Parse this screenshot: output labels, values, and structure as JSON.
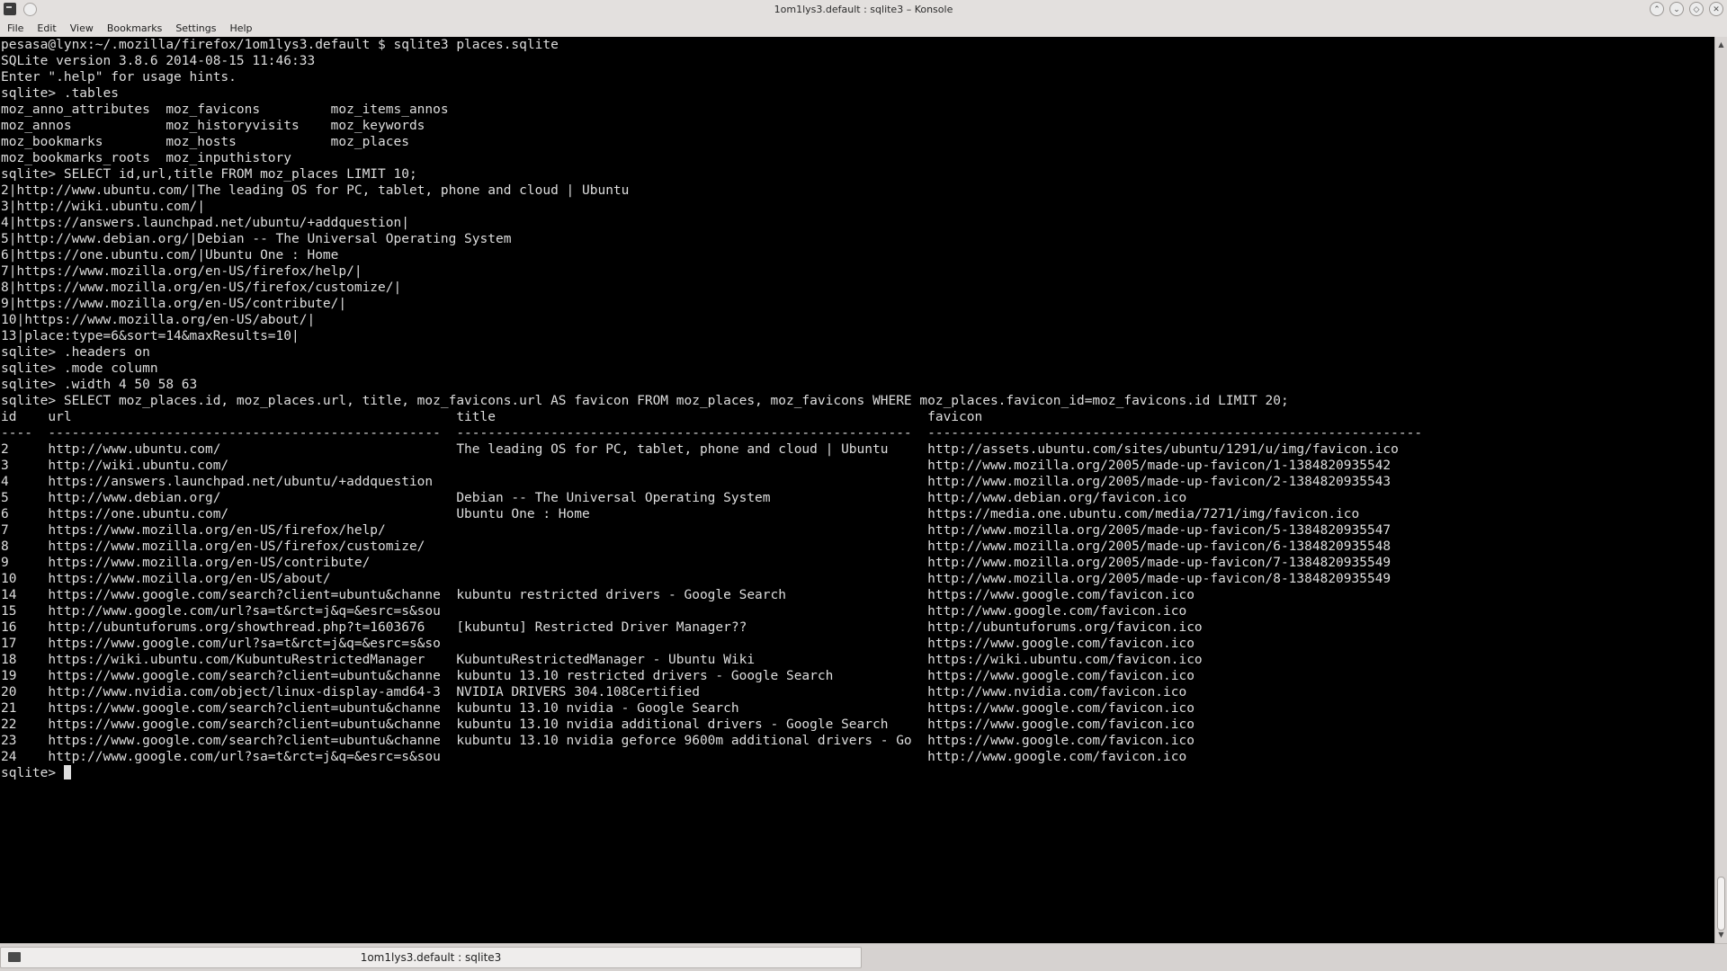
{
  "window": {
    "title": "1om1lys3.default : sqlite3 – Konsole"
  },
  "menubar": {
    "items": [
      "File",
      "Edit",
      "View",
      "Bookmarks",
      "Settings",
      "Help"
    ]
  },
  "terminal": {
    "lines": [
      "pesasa@lynx:~/.mozilla/firefox/1om1lys3.default $ sqlite3 places.sqlite",
      "SQLite version 3.8.6 2014-08-15 11:46:33",
      "Enter \".help\" for usage hints.",
      "sqlite> .tables",
      "moz_anno_attributes  moz_favicons         moz_items_annos",
      "moz_annos            moz_historyvisits    moz_keywords",
      "moz_bookmarks        moz_hosts            moz_places",
      "moz_bookmarks_roots  moz_inputhistory",
      "sqlite> SELECT id,url,title FROM moz_places LIMIT 10;",
      "2|http://www.ubuntu.com/|The leading OS for PC, tablet, phone and cloud | Ubuntu",
      "3|http://wiki.ubuntu.com/|",
      "4|https://answers.launchpad.net/ubuntu/+addquestion|",
      "5|http://www.debian.org/|Debian -- The Universal Operating System",
      "6|https://one.ubuntu.com/|Ubuntu One : Home",
      "7|https://www.mozilla.org/en-US/firefox/help/|",
      "8|https://www.mozilla.org/en-US/firefox/customize/|",
      "9|https://www.mozilla.org/en-US/contribute/|",
      "10|https://www.mozilla.org/en-US/about/|",
      "13|place:type=6&sort=14&maxResults=10|",
      "sqlite> .headers on",
      "sqlite> .mode column",
      "sqlite> .width 4 50 58 63",
      "sqlite> SELECT moz_places.id, moz_places.url, title, moz_favicons.url AS favicon FROM moz_places, moz_favicons WHERE moz_places.favicon_id=moz_favicons.id LIMIT 20;",
      "id    url                                                 title                                                       favicon",
      "----  --------------------------------------------------  ----------------------------------------------------------  ---------------------------------------------------------------",
      "2     http://www.ubuntu.com/                              The leading OS for PC, tablet, phone and cloud | Ubuntu     http://assets.ubuntu.com/sites/ubuntu/1291/u/img/favicon.ico",
      "3     http://wiki.ubuntu.com/                                                                                         http://www.mozilla.org/2005/made-up-favicon/1-1384820935542",
      "4     https://answers.launchpad.net/ubuntu/+addquestion                                                               http://www.mozilla.org/2005/made-up-favicon/2-1384820935543",
      "5     http://www.debian.org/                              Debian -- The Universal Operating System                    http://www.debian.org/favicon.ico",
      "6     https://one.ubuntu.com/                             Ubuntu One : Home                                           https://media.one.ubuntu.com/media/7271/img/favicon.ico",
      "7     https://www.mozilla.org/en-US/firefox/help/                                                                     http://www.mozilla.org/2005/made-up-favicon/5-1384820935547",
      "8     https://www.mozilla.org/en-US/firefox/customize/                                                                http://www.mozilla.org/2005/made-up-favicon/6-1384820935548",
      "9     https://www.mozilla.org/en-US/contribute/                                                                       http://www.mozilla.org/2005/made-up-favicon/7-1384820935549",
      "10    https://www.mozilla.org/en-US/about/                                                                            http://www.mozilla.org/2005/made-up-favicon/8-1384820935549",
      "14    https://www.google.com/search?client=ubuntu&channe  kubuntu restricted drivers - Google Search                  https://www.google.com/favicon.ico",
      "15    http://www.google.com/url?sa=t&rct=j&q=&esrc=s&sou                                                              http://www.google.com/favicon.ico",
      "16    http://ubuntuforums.org/showthread.php?t=1603676    [kubuntu] Restricted Driver Manager??                       http://ubuntuforums.org/favicon.ico",
      "17    https://www.google.com/url?sa=t&rct=j&q=&esrc=s&so                                                              https://www.google.com/favicon.ico",
      "18    https://wiki.ubuntu.com/KubuntuRestrictedManager    KubuntuRestrictedManager - Ubuntu Wiki                      https://wiki.ubuntu.com/favicon.ico",
      "19    https://www.google.com/search?client=ubuntu&channe  kubuntu 13.10 restricted drivers - Google Search            https://www.google.com/favicon.ico",
      "20    http://www.nvidia.com/object/linux-display-amd64-3  NVIDIA DRIVERS 304.108Certified                             http://www.nvidia.com/favicon.ico",
      "21    https://www.google.com/search?client=ubuntu&channe  kubuntu 13.10 nvidia - Google Search                        https://www.google.com/favicon.ico",
      "22    https://www.google.com/search?client=ubuntu&channe  kubuntu 13.10 nvidia additional drivers - Google Search     https://www.google.com/favicon.ico",
      "23    https://www.google.com/search?client=ubuntu&channe  kubuntu 13.10 nvidia geforce 9600m additional drivers - Go  https://www.google.com/favicon.ico",
      "24    http://www.google.com/url?sa=t&rct=j&q=&esrc=s&sou                                                              http://www.google.com/favicon.ico"
    ],
    "prompt": "sqlite> "
  },
  "tabs": [
    {
      "label": "1om1lys3.default : sqlite3"
    }
  ],
  "icons": {
    "app": "terminal-icon",
    "pin": "pin-icon",
    "keep_above": "chevron-up-icon",
    "minimize": "chevron-down-icon",
    "maximize": "maximize-icon",
    "close": "close-icon",
    "tab": "terminal-icon"
  },
  "colors": {
    "terminal_bg": "#000000",
    "terminal_fg": "#dedede",
    "chrome_bg": "#e3e0de"
  }
}
